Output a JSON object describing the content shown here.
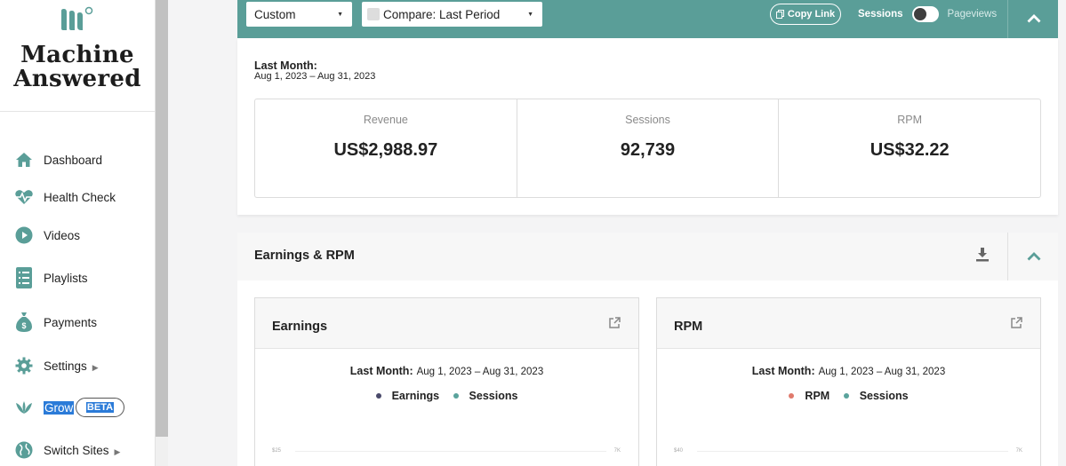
{
  "brand": {
    "name_line1": "Machine",
    "name_line2": "Answered"
  },
  "sidebar": {
    "items": [
      {
        "label": "Dashboard",
        "icon": "home-icon"
      },
      {
        "label": "Health Check",
        "icon": "heartbeat-icon"
      },
      {
        "label": "Videos",
        "icon": "play-icon"
      },
      {
        "label": "Playlists",
        "icon": "list-icon"
      },
      {
        "label": "Payments",
        "icon": "money-bag-icon"
      },
      {
        "label": "Settings",
        "icon": "gear-icon"
      },
      {
        "label": "Grow",
        "icon": "leaf-icon",
        "badge": "BETA"
      },
      {
        "label": "Switch Sites",
        "icon": "globe-icon"
      }
    ]
  },
  "filters": {
    "range_select": "Custom",
    "compare_select": "Compare: Last Period",
    "copy_link": "Copy Link",
    "toggle_left": "Sessions",
    "toggle_right": "Pageviews"
  },
  "summary": {
    "period_title": "Last Month:",
    "period_range": "Aug 1, 2023 – Aug 31, 2023",
    "stats": [
      {
        "label": "Revenue",
        "value": "US$2,988.97"
      },
      {
        "label": "Sessions",
        "value": "92,739"
      },
      {
        "label": "RPM",
        "value": "US$32.22"
      }
    ]
  },
  "earnings_section": {
    "title": "Earnings & RPM",
    "cards": [
      {
        "title": "Earnings",
        "period_label": "Last Month:",
        "period_range": "Aug 1, 2023 – Aug 31, 2023",
        "legend": [
          {
            "name": "Earnings",
            "color": "#4a4a6a"
          },
          {
            "name": "Sessions",
            "color": "#5aa39c"
          }
        ],
        "axis_left": "$25",
        "axis_right": "7K"
      },
      {
        "title": "RPM",
        "period_label": "Last Month:",
        "period_range": "Aug 1, 2023 – Aug 31, 2023",
        "legend": [
          {
            "name": "RPM",
            "color": "#e07a6c"
          },
          {
            "name": "Sessions",
            "color": "#5aa39c"
          }
        ],
        "axis_left": "$40",
        "axis_right": "7K"
      }
    ]
  },
  "colors": {
    "accent": "#5a9e98",
    "selection": "#2b7bd8"
  }
}
